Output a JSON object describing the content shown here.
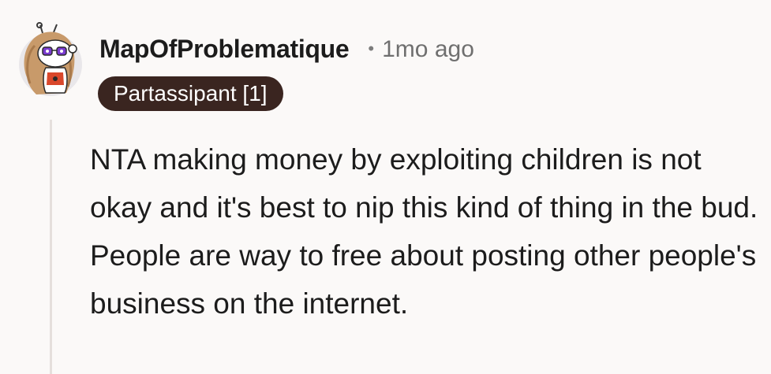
{
  "comment": {
    "username": "MapOfProblematique",
    "separator": "•",
    "timestamp": "1mo ago",
    "flair": "Partassipant [1]",
    "body": "NTA making money by exploiting children is not okay and it's best to nip this kind of thing in the bud. People are way to free about posting other people's business on the internet."
  },
  "colors": {
    "background": "#fbf9f8",
    "flair_background": "#3a2520",
    "flair_text": "#ffffff",
    "username": "#1c1c1c",
    "timestamp": "#6f6f6f",
    "thread_line": "#e5dfdc"
  },
  "icons": {
    "avatar": "snoo-avatar-icon"
  }
}
